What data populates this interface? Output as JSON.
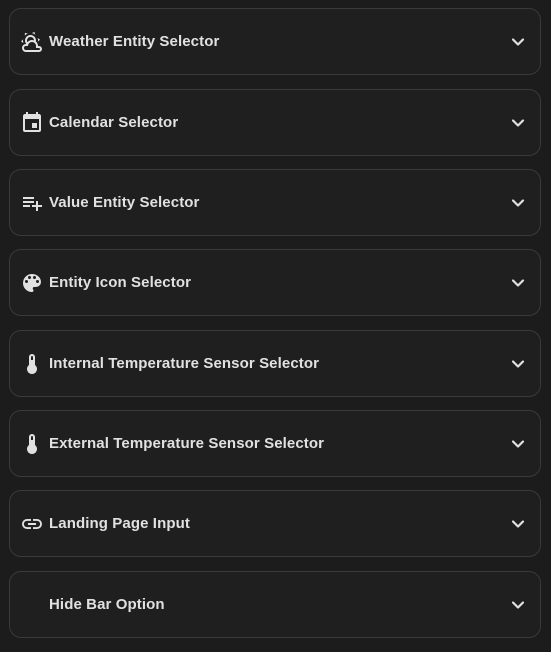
{
  "panels": [
    {
      "label": "Weather Entity Selector",
      "icon": "weather-partly-cloudy-icon"
    },
    {
      "label": "Calendar Selector",
      "icon": "calendar-icon"
    },
    {
      "label": "Value Entity Selector",
      "icon": "playlist-plus-icon"
    },
    {
      "label": "Entity Icon Selector",
      "icon": "palette-icon"
    },
    {
      "label": "Internal Temperature Sensor Selector",
      "icon": "thermometer-icon"
    },
    {
      "label": "External Temperature Sensor Selector",
      "icon": "thermometer-icon"
    },
    {
      "label": "Landing Page Input",
      "icon": "link-icon"
    },
    {
      "label": "Hide Bar Option",
      "icon": ""
    }
  ],
  "colors": {
    "background": "#1c1c1c",
    "panel_background": "#1f1f1f",
    "panel_border": "#3a3a3a",
    "text": "#e1e1e1"
  }
}
